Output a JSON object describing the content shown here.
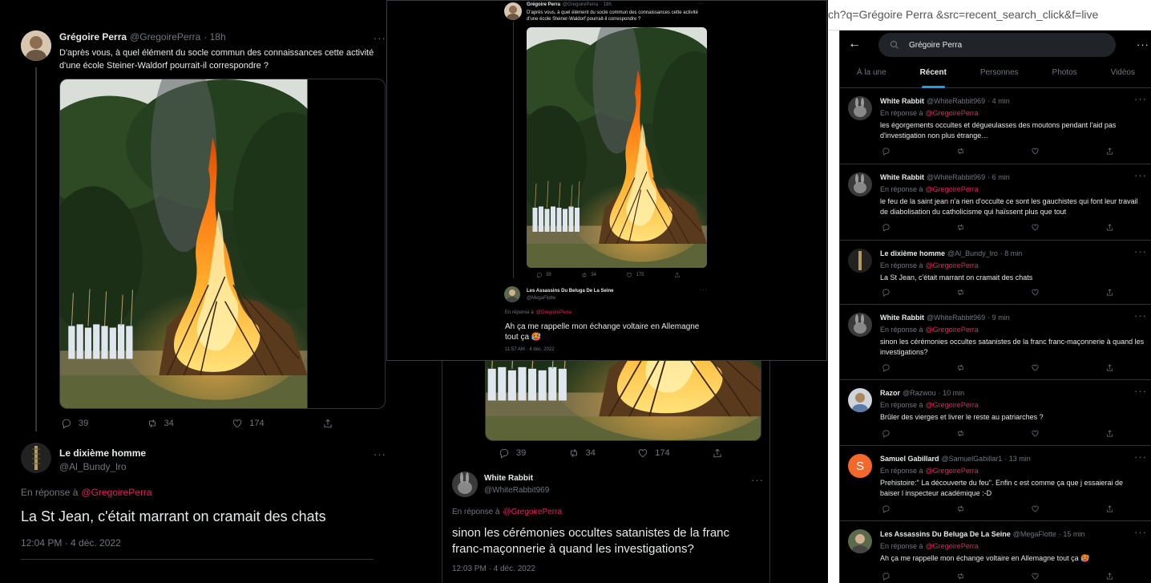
{
  "main_tweet": {
    "author_name": "Grégoire Perra",
    "author_handle": "@GregoirePerra",
    "time": "· 18h",
    "text": "D'après vous, à quel élément du socle commun des connaissances cette activité d'une école Steiner-Waldorf pourrait-il correspondre ?",
    "replies": "39",
    "retweets": "34",
    "likes": "174",
    "replies_small": "39",
    "retweets_small": "34",
    "likes_small": "175"
  },
  "reply_dixieme": {
    "author_name": "Le dixième homme",
    "author_handle": "@Al_Bundy_lro",
    "replying_prefix": "En réponse à",
    "replying_to": "@GregoirePerra",
    "text": "La St Jean, c'était marrant on cramait des chats",
    "timestamp": "12:04 PM · 4 déc. 2022"
  },
  "reply_white_rabbit": {
    "author_name": "White Rabbit",
    "author_handle": "@WhiteRabbit969",
    "replying_prefix": "En réponse à",
    "replying_to": "@GregoirePerra",
    "text": "sinon les cérémonies occultes satanistes de la franc franc-maçonnerie à quand les investigations?",
    "timestamp": "12:03 PM · 4 déc. 2022"
  },
  "reply_beluga": {
    "author_name": "Les Assassins Du Beluga De La Seine",
    "author_handle": "@MegaFlotte",
    "replying_prefix": "En réponse à",
    "replying_to": "@GregoirePerra",
    "text": "Ah ça me rappelle mon échange voltaire en Allemagne tout ça 🥵",
    "timestamp": "11:57 AM · 4 déc. 2022"
  },
  "search": {
    "url_text": "ch?q=Grégoire Perra &src=recent_search_click&f=live",
    "query": "Grégoire Perra",
    "tabs": [
      "À la une",
      "Récent",
      "Personnes",
      "Photos",
      "Vidéos"
    ],
    "active_tab": "Récent",
    "results": [
      {
        "name": "White Rabbit",
        "handle": "@WhiteRabbit969",
        "time": "· 4 min",
        "prefix": "En réponse à",
        "reply_to": "@GregoirePerra",
        "text": "les égorgements occultes et dégueulasses des moutons pendant l'aid pas d'investigation non plus étrange…"
      },
      {
        "name": "White Rabbit",
        "handle": "@WhiteRabbit969",
        "time": "· 6 min",
        "prefix": "En réponse à",
        "reply_to": "@GregoirePerra",
        "text": "le feu de la saint jean n'a rien d'occulte ce sont les gauchistes qui font leur travail de diabolisation du catholicisme qui haïssent plus que tout"
      },
      {
        "name": "Le dixième homme",
        "handle": "@Al_Bundy_lro",
        "time": "· 8 min",
        "prefix": "En réponse à",
        "reply_to": "@GregoirePerra",
        "text": "La St Jean, c'était marrant on cramait des chats"
      },
      {
        "name": "White Rabbit",
        "handle": "@WhiteRabbit969",
        "time": "· 9 min",
        "prefix": "En réponse à",
        "reply_to": "@GregoirePerra",
        "text": "sinon les cérémonies occultes satanistes de la franc franc-maçonnerie à quand les investigations?"
      },
      {
        "name": "Razor",
        "handle": "@Razwou",
        "time": "· 10 min",
        "prefix": "En réponse à",
        "reply_to": "@GregoirePerra",
        "text": "Brûler des vierges et livrer le reste au patriarches ?"
      },
      {
        "name": "Samuel Gabillard",
        "handle": "@SamuelGabillar1",
        "time": "· 13 min",
        "prefix": "En réponse à",
        "reply_to": "@GregoirePerra",
        "text": "Prehistoire:\" La découverte du feu\". Enfin c est comme ça que j essaierai de baiser l inspecteur académique :-D",
        "avatar_letter": "S"
      },
      {
        "name": "Les Assassins Du Beluga De La Seine",
        "handle": "@MegaFlotte",
        "time": "· 15 min",
        "prefix": "En réponse à",
        "reply_to": "@GregoirePerra",
        "text": "Ah ça me rappelle mon échange voltaire en Allemagne tout ça 🥵"
      }
    ]
  },
  "colors": {
    "background": "#000000",
    "text": "#e7e9ea",
    "muted": "#71767b",
    "mention": "#e0245e",
    "accent": "#1d9bf0",
    "avatar_orange": "#f4682c"
  },
  "icons": [
    "reply-icon",
    "retweet-icon",
    "like-icon",
    "share-icon",
    "more-icon",
    "back-arrow-icon",
    "search-icon"
  ]
}
